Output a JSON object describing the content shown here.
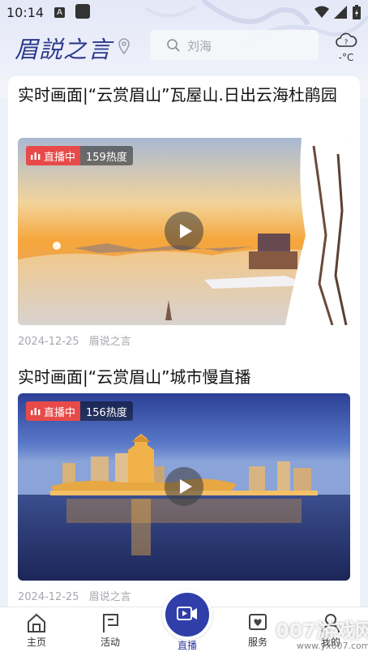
{
  "status_bar": {
    "time": "10:14",
    "notification_letter": "A"
  },
  "header": {
    "logo_text": "眉説之言",
    "search": {
      "placeholder": "刘海"
    },
    "weather": {
      "temperature": "-°C"
    }
  },
  "feed": {
    "items": [
      {
        "title": "实时画面|“云赏眉山”瓦屋山.日出云海杜鹃园",
        "live_label": "直播中",
        "heat": "159热度",
        "date": "2024-12-25",
        "source": "眉说之言"
      },
      {
        "title": "实时画面|“云赏眉山”城市慢直播",
        "live_label": "直播中",
        "heat": "156热度",
        "date": "2024-12-25",
        "source": "眉说之言"
      }
    ]
  },
  "bottom_nav": {
    "items": [
      {
        "label": "主页",
        "icon": "home-icon"
      },
      {
        "label": "活动",
        "icon": "flag-icon"
      },
      {
        "label": "直播",
        "icon": "video-icon"
      },
      {
        "label": "服务",
        "icon": "heart-icon"
      },
      {
        "label": "我的",
        "icon": "user-icon"
      }
    ]
  },
  "watermark": {
    "text": "007游戏网",
    "url": "www.yx007.com"
  },
  "colors": {
    "accent": "#2f3ea8",
    "live_red": "#e84a4a",
    "logo_blue": "#2b3a8c"
  }
}
